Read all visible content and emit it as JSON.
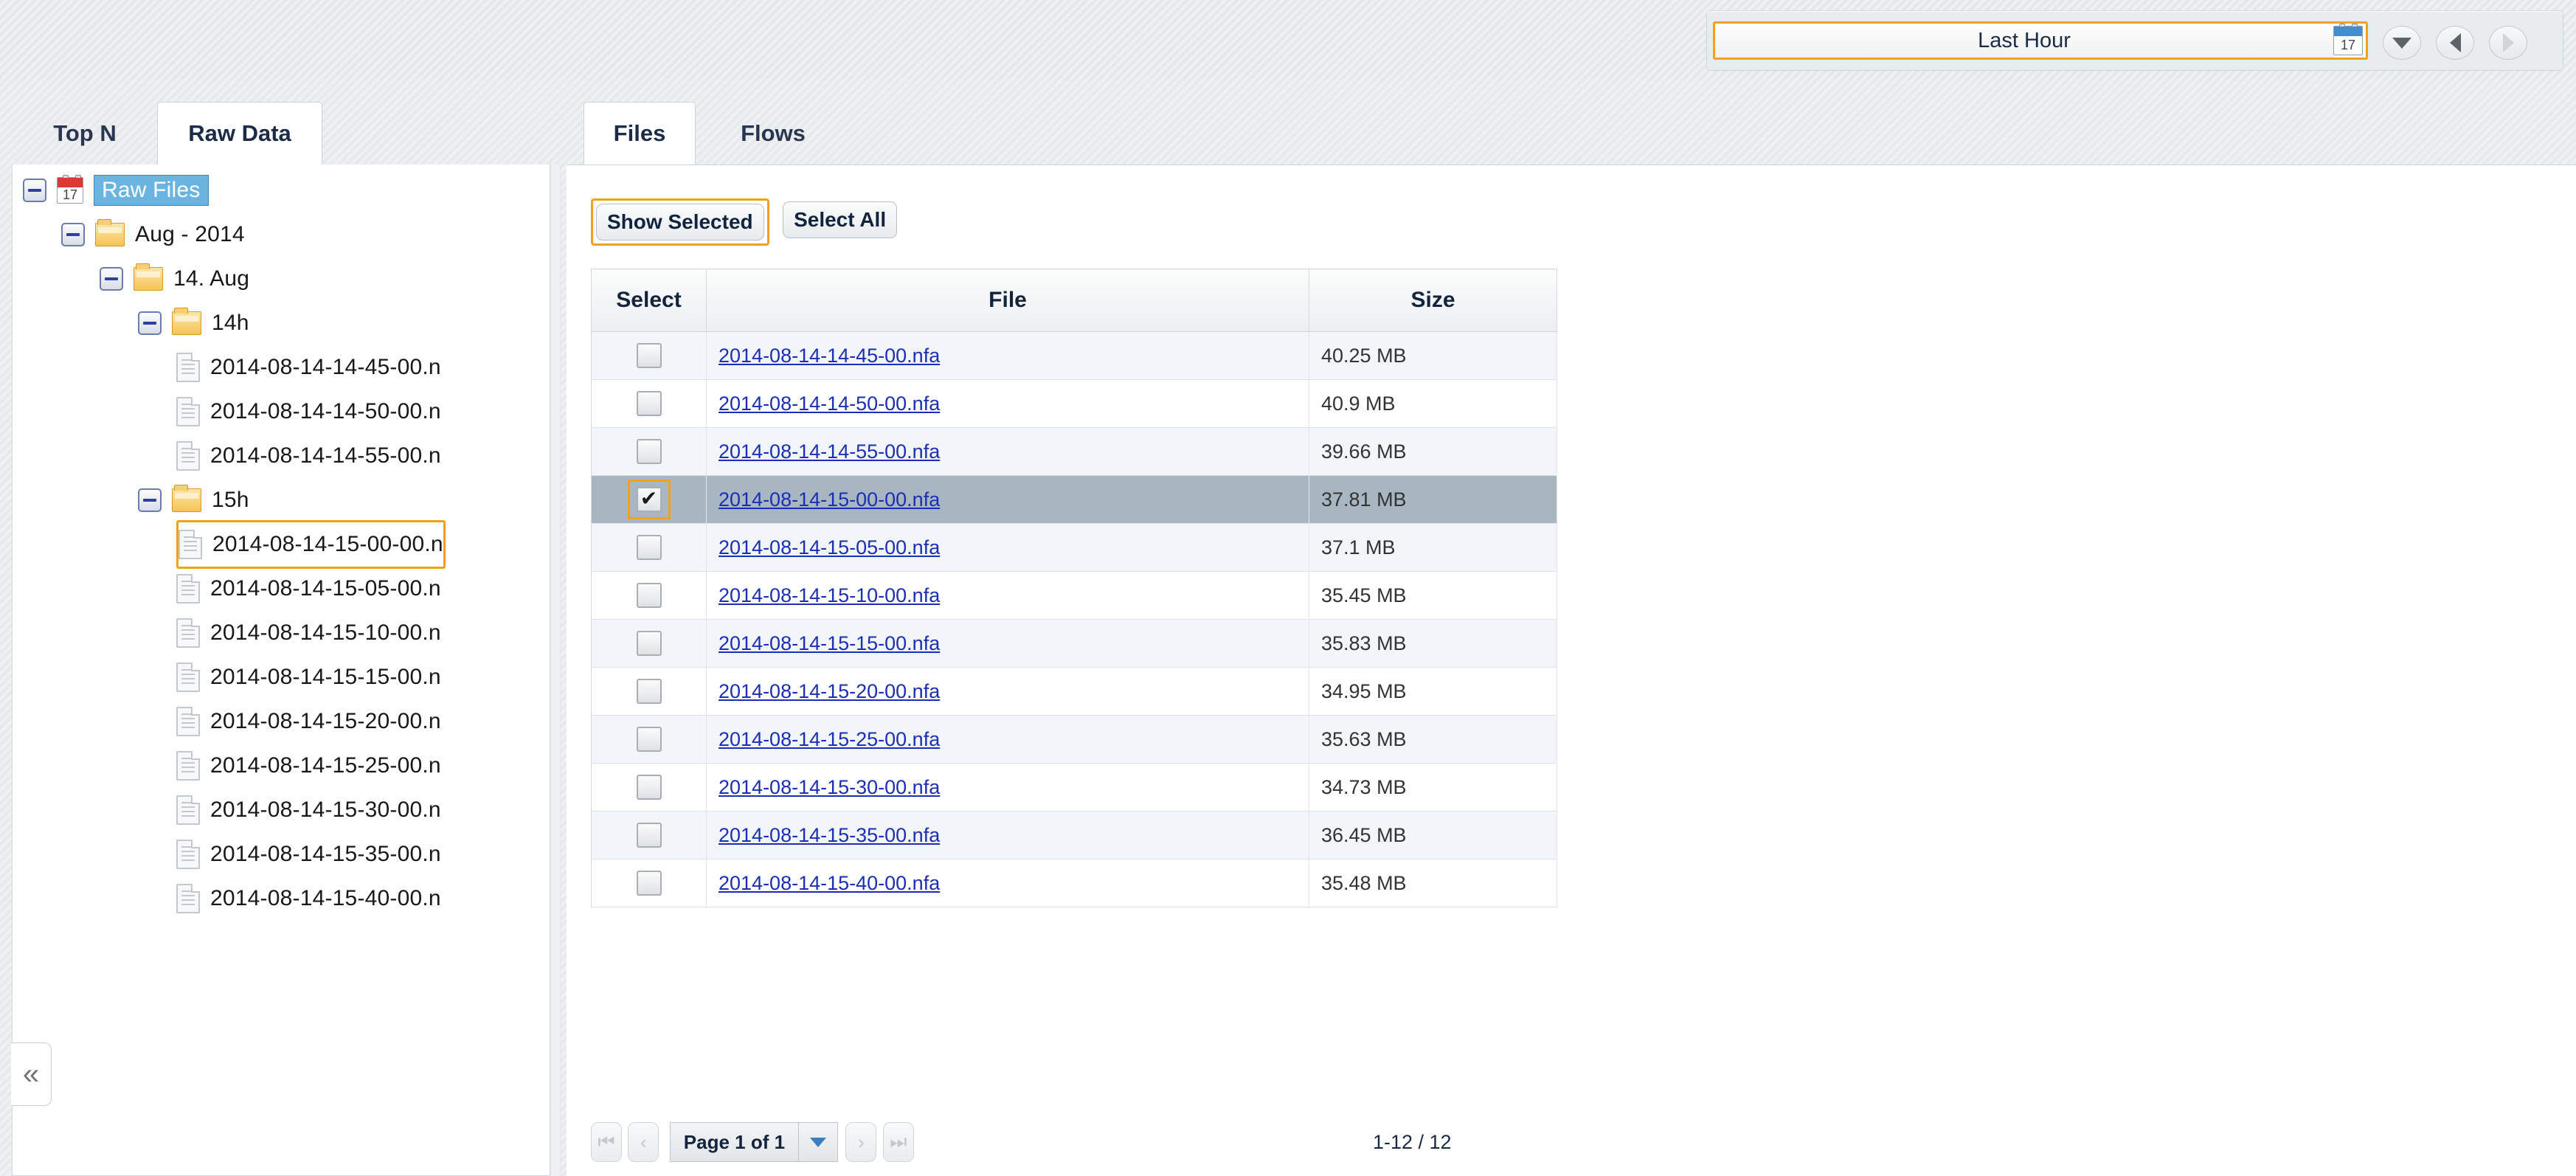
{
  "topbar": {
    "time_range": {
      "value": "Last Hour",
      "calendar_day": "17"
    },
    "nav": {
      "dropdown": "▼",
      "prev": "◀",
      "next": "▶"
    }
  },
  "left_panel": {
    "tabs": [
      {
        "label": "Top N",
        "active": false
      },
      {
        "label": "Raw Data",
        "active": true
      }
    ],
    "collapse_label": "«",
    "tree": [
      {
        "label": "Raw Files",
        "depth": 0,
        "icon": "calendar",
        "expander": "minus",
        "selected": true,
        "focused": false
      },
      {
        "label": "Aug - 2014",
        "depth": 1,
        "icon": "folder",
        "expander": "minus",
        "selected": false,
        "focused": false
      },
      {
        "label": "14. Aug",
        "depth": 2,
        "icon": "folder",
        "expander": "minus",
        "selected": false,
        "focused": false
      },
      {
        "label": "14h",
        "depth": 3,
        "icon": "folder",
        "expander": "minus",
        "selected": false,
        "focused": false
      },
      {
        "label": "2014-08-14-14-45-00.n",
        "depth": 4,
        "icon": "file",
        "expander": "none",
        "selected": false,
        "focused": false
      },
      {
        "label": "2014-08-14-14-50-00.n",
        "depth": 4,
        "icon": "file",
        "expander": "none",
        "selected": false,
        "focused": false
      },
      {
        "label": "2014-08-14-14-55-00.n",
        "depth": 4,
        "icon": "file",
        "expander": "none",
        "selected": false,
        "focused": false
      },
      {
        "label": "15h",
        "depth": 3,
        "icon": "folder",
        "expander": "minus",
        "selected": false,
        "focused": false
      },
      {
        "label": "2014-08-14-15-00-00.n",
        "depth": 4,
        "icon": "file",
        "expander": "none",
        "selected": false,
        "focused": true
      },
      {
        "label": "2014-08-14-15-05-00.n",
        "depth": 4,
        "icon": "file",
        "expander": "none",
        "selected": false,
        "focused": false
      },
      {
        "label": "2014-08-14-15-10-00.n",
        "depth": 4,
        "icon": "file",
        "expander": "none",
        "selected": false,
        "focused": false
      },
      {
        "label": "2014-08-14-15-15-00.n",
        "depth": 4,
        "icon": "file",
        "expander": "none",
        "selected": false,
        "focused": false
      },
      {
        "label": "2014-08-14-15-20-00.n",
        "depth": 4,
        "icon": "file",
        "expander": "none",
        "selected": false,
        "focused": false
      },
      {
        "label": "2014-08-14-15-25-00.n",
        "depth": 4,
        "icon": "file",
        "expander": "none",
        "selected": false,
        "focused": false
      },
      {
        "label": "2014-08-14-15-30-00.n",
        "depth": 4,
        "icon": "file",
        "expander": "none",
        "selected": false,
        "focused": false
      },
      {
        "label": "2014-08-14-15-35-00.n",
        "depth": 4,
        "icon": "file",
        "expander": "none",
        "selected": false,
        "focused": false
      },
      {
        "label": "2014-08-14-15-40-00.n",
        "depth": 4,
        "icon": "file",
        "expander": "none",
        "selected": false,
        "focused": false
      }
    ]
  },
  "right_panel": {
    "tabs": [
      {
        "label": "Files",
        "active": true
      },
      {
        "label": "Flows",
        "active": false
      }
    ],
    "toolbar": {
      "show_selected_label": "Show Selected",
      "select_all_label": "Select All"
    },
    "table": {
      "columns": [
        "Select",
        "File",
        "Size"
      ],
      "rows": [
        {
          "checked": false,
          "focused": false,
          "selected": false,
          "file": "2014-08-14-14-45-00.nfa",
          "size": "40.25 MB"
        },
        {
          "checked": false,
          "focused": false,
          "selected": false,
          "file": "2014-08-14-14-50-00.nfa",
          "size": "40.9 MB"
        },
        {
          "checked": false,
          "focused": false,
          "selected": false,
          "file": "2014-08-14-14-55-00.nfa",
          "size": "39.66 MB"
        },
        {
          "checked": true,
          "focused": true,
          "selected": true,
          "file": "2014-08-14-15-00-00.nfa",
          "size": "37.81 MB"
        },
        {
          "checked": false,
          "focused": false,
          "selected": false,
          "file": "2014-08-14-15-05-00.nfa",
          "size": "37.1 MB"
        },
        {
          "checked": false,
          "focused": false,
          "selected": false,
          "file": "2014-08-14-15-10-00.nfa",
          "size": "35.45 MB"
        },
        {
          "checked": false,
          "focused": false,
          "selected": false,
          "file": "2014-08-14-15-15-00.nfa",
          "size": "35.83 MB"
        },
        {
          "checked": false,
          "focused": false,
          "selected": false,
          "file": "2014-08-14-15-20-00.nfa",
          "size": "34.95 MB"
        },
        {
          "checked": false,
          "focused": false,
          "selected": false,
          "file": "2014-08-14-15-25-00.nfa",
          "size": "35.63 MB"
        },
        {
          "checked": false,
          "focused": false,
          "selected": false,
          "file": "2014-08-14-15-30-00.nfa",
          "size": "34.73 MB"
        },
        {
          "checked": false,
          "focused": false,
          "selected": false,
          "file": "2014-08-14-15-35-00.nfa",
          "size": "36.45 MB"
        },
        {
          "checked": false,
          "focused": false,
          "selected": false,
          "file": "2014-08-14-15-40-00.nfa",
          "size": "35.48 MB"
        }
      ]
    },
    "pager": {
      "first": "⏮",
      "prev": "‹",
      "page_label": "Page 1 of 1",
      "next": "›",
      "last": "⏭",
      "range": "1-12 / 12"
    }
  }
}
